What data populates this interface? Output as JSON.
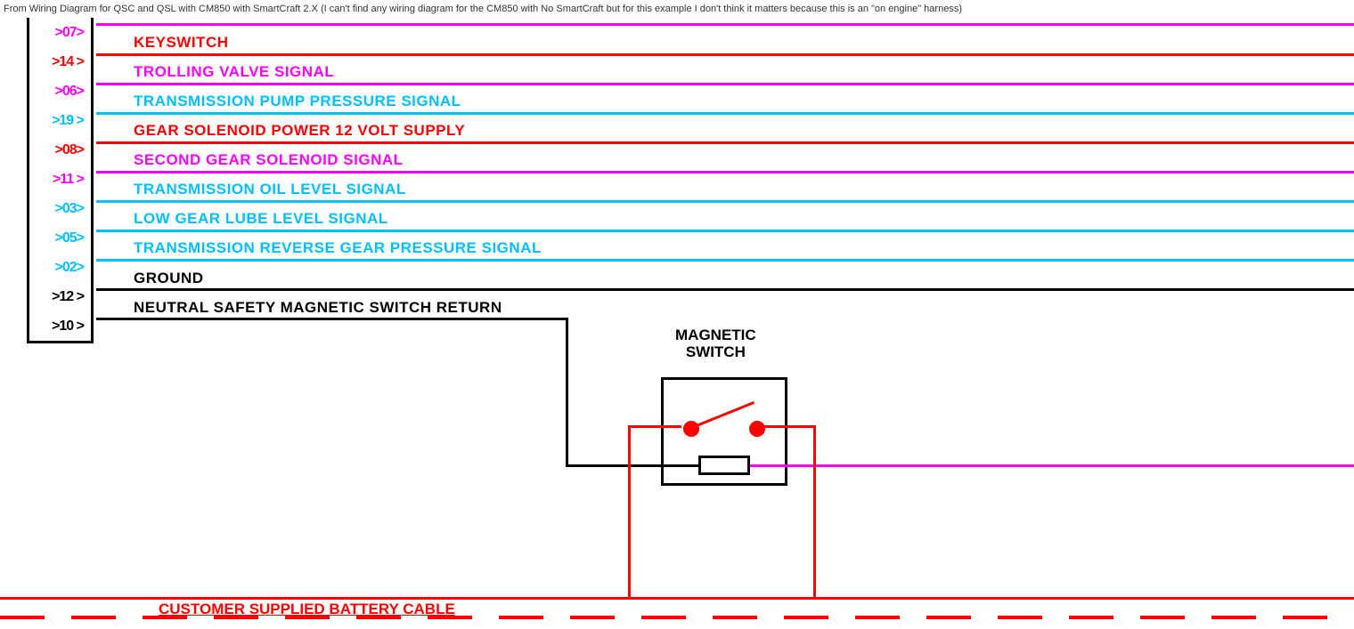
{
  "caption": "From Wiring Diagram for QSC and QSL with CM850 with SmartCraft 2.X (I can't find any wiring diagram for the CM850 with No SmartCraft but for this example I don't think it matters because this is an \"on engine\" harness)",
  "wires": [
    {
      "pin": ">07>",
      "label": "",
      "color": "magenta"
    },
    {
      "pin": ">14 >",
      "label": "KEYSWITCH",
      "color": "red"
    },
    {
      "pin": ">06>",
      "label": "TROLLING VALVE SIGNAL",
      "color": "magenta"
    },
    {
      "pin": ">19 >",
      "label": "TRANSMISSION PUMP PRESSURE SIGNAL",
      "color": "cyan"
    },
    {
      "pin": ">08>",
      "label": "GEAR SOLENOID POWER 12 VOLT SUPPLY",
      "color": "red"
    },
    {
      "pin": ">11 >",
      "label": "SECOND GEAR SOLENOID SIGNAL",
      "color": "magenta"
    },
    {
      "pin": ">03>",
      "label": "TRANSMISSION OIL LEVEL SIGNAL",
      "color": "cyan"
    },
    {
      "pin": ">05>",
      "label": "LOW GEAR LUBE LEVEL SIGNAL",
      "color": "cyan"
    },
    {
      "pin": ">02>",
      "label": "TRANSMISSION REVERSE GEAR PRESSURE SIGNAL",
      "color": "cyan"
    },
    {
      "pin": ">12 >",
      "label": "GROUND",
      "color": "black"
    },
    {
      "pin": ">10 >",
      "label": "NEUTRAL SAFETY MAGNETIC SWITCH RETURN",
      "color": "black"
    }
  ],
  "magnetic_switch": {
    "title1": "MAGNETIC",
    "title2": "SWITCH"
  },
  "battery_cable_label": "CUSTOMER SUPPLIED BATTERY CABLE"
}
